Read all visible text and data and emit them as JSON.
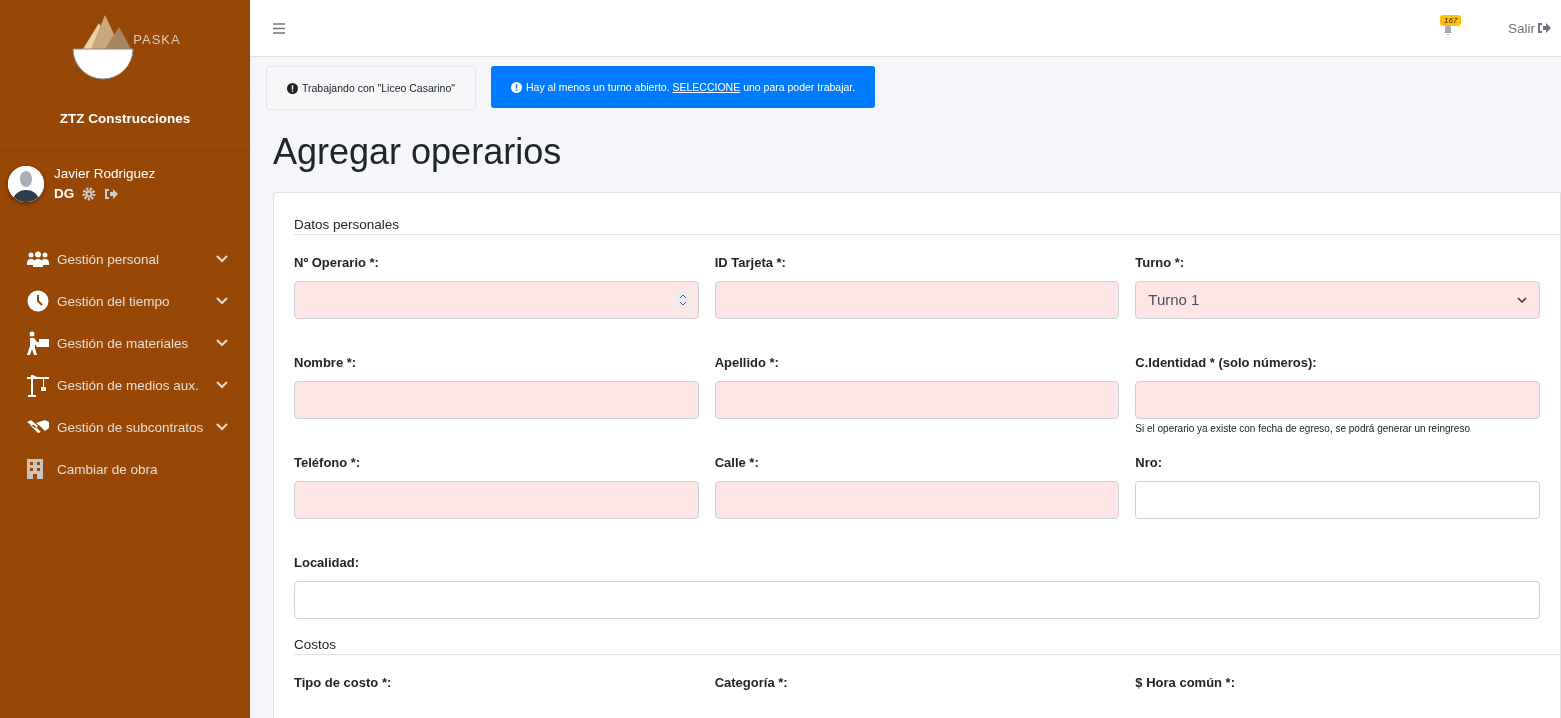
{
  "sidebar": {
    "logo_text": "PASKA",
    "company": "ZTZ Construcciones",
    "user": {
      "name": "Javier Rodriguez",
      "role": "DG"
    },
    "items": [
      {
        "label": "Gestión personal",
        "expandable": true
      },
      {
        "label": "Gestión del tiempo",
        "expandable": true
      },
      {
        "label": "Gestión de materiales",
        "expandable": true
      },
      {
        "label": "Gestión de medios aux.",
        "expandable": true
      },
      {
        "label": "Gestión de subcontratos",
        "expandable": true
      },
      {
        "label": "Cambiar de obra",
        "expandable": false
      }
    ]
  },
  "topbar": {
    "notifications": "167",
    "logout": "Salir"
  },
  "alerts": [
    {
      "kind": "plain",
      "text": "Trabajando con \"Liceo Casarino\""
    },
    {
      "kind": "primary",
      "text": "Hay al menos un turno abierto.",
      "link": "SELECCIONE",
      "text_after": "uno para poder trabajar."
    }
  ],
  "title": "Agregar operarios",
  "sections": [
    {
      "heading": "Datos personales",
      "fields": [
        {
          "label": "Nº Operario *:",
          "kind": "number",
          "required": true
        },
        {
          "label": "ID Tarjeta *:",
          "kind": "text",
          "required": true
        },
        {
          "label": "Turno *:",
          "kind": "select",
          "required": true,
          "value": "Turno 1"
        },
        {
          "label": "Nombre *:",
          "kind": "text",
          "required": true
        },
        {
          "label": "Apellido *:",
          "kind": "text",
          "required": true
        },
        {
          "label": "C.Identidad * (solo números):",
          "kind": "text",
          "required": true,
          "help": "Si el operario ya existe con fecha de egreso, se podrá generar un reingreso"
        },
        {
          "label": "Teléfono *:",
          "kind": "text",
          "required": true
        },
        {
          "label": "Calle *:",
          "kind": "text",
          "required": true
        },
        {
          "label": "Nro:",
          "kind": "text",
          "required": false
        },
        {
          "label": "Localidad:",
          "kind": "text",
          "required": false,
          "wide": true
        }
      ]
    },
    {
      "heading": "Costos",
      "fields": [
        {
          "label": "Tipo de costo *:",
          "kind": "hidden"
        },
        {
          "label": "Categoría *:",
          "kind": "hidden"
        },
        {
          "label": "$ Hora común *:",
          "kind": "hidden"
        }
      ]
    }
  ]
}
